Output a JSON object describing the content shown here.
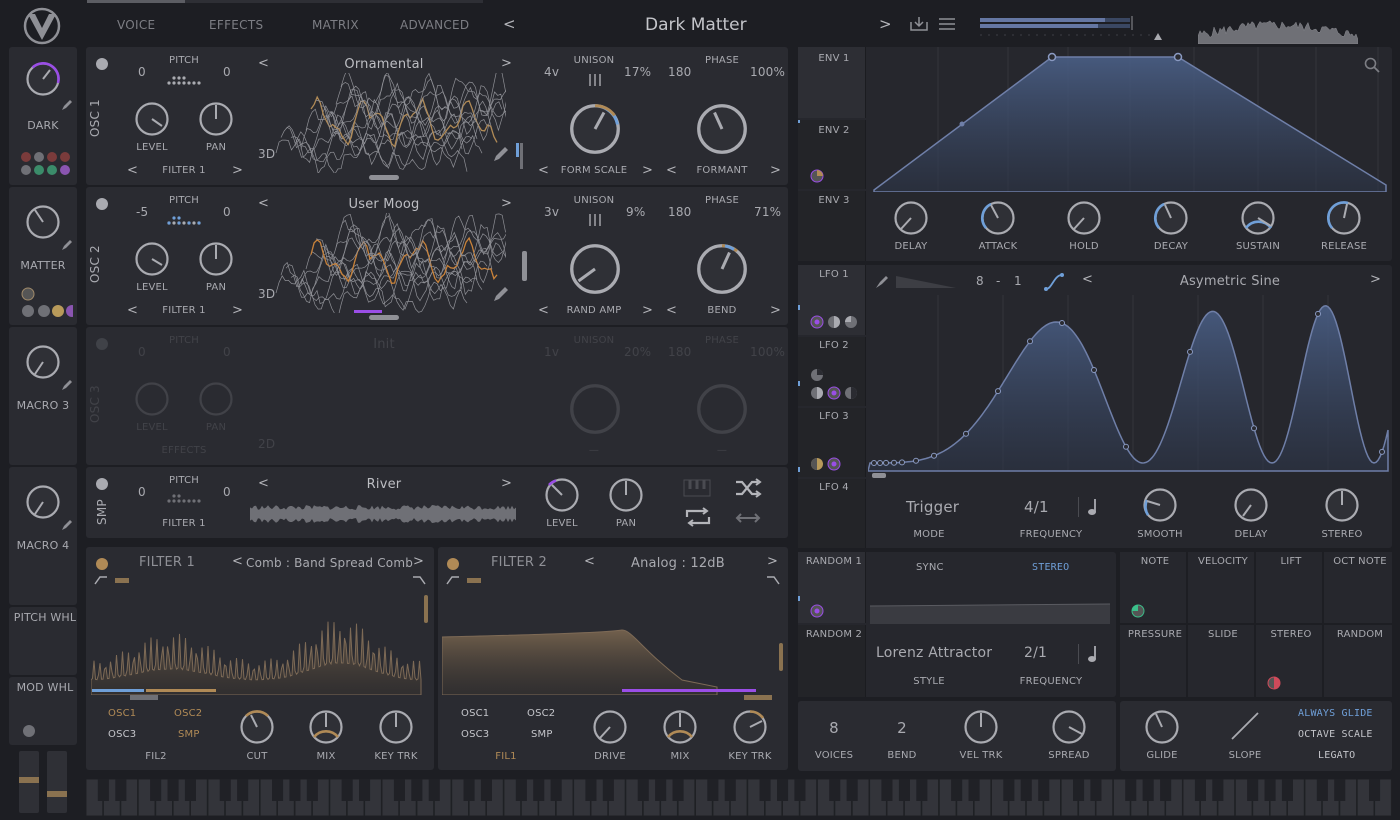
{
  "header": {
    "tabs": [
      "VOICE",
      "EFFECTS",
      "MATRIX",
      "ADVANCED"
    ],
    "preset_name": "Dark Matter",
    "prev": "<",
    "next": ">"
  },
  "macros": [
    {
      "label": "DARK"
    },
    {
      "label": "MATTER"
    },
    {
      "label": "MACRO 3"
    },
    {
      "label": "MACRO 4"
    }
  ],
  "wheels": {
    "pitch": "PITCH WHL",
    "mod": "MOD WHL"
  },
  "osc1": {
    "label": "OSC 1",
    "pitch_label": "PITCH",
    "pitch_left": "0",
    "pitch_right": "0",
    "level": "LEVEL",
    "pan": "PAN",
    "dest": "FILTER 1",
    "wavetable": "Ornamental",
    "view": "3D",
    "unison_label": "UNISON",
    "voices": "4v",
    "detune": "17%",
    "phase_label": "PHASE",
    "phase": "180",
    "phase_rand": "100%",
    "mod1": "FORM SCALE",
    "mod2": "FORMANT"
  },
  "osc2": {
    "label": "OSC 2",
    "pitch_label": "PITCH",
    "pitch_left": "-5",
    "pitch_right": "0",
    "level": "LEVEL",
    "pan": "PAN",
    "dest": "FILTER 1",
    "wavetable": "User Moog",
    "view": "3D",
    "unison_label": "UNISON",
    "voices": "3v",
    "detune": "9%",
    "phase_label": "PHASE",
    "phase": "180",
    "phase_rand": "71%",
    "mod1": "RAND AMP",
    "mod2": "BEND"
  },
  "osc3": {
    "label": "OSC 3",
    "pitch_label": "PITCH",
    "pitch_left": "0",
    "pitch_right": "0",
    "level": "LEVEL",
    "pan": "PAN",
    "dest": "EFFECTS",
    "wavetable": "Init",
    "view": "2D",
    "unison_label": "UNISON",
    "voices": "1v",
    "detune": "20%",
    "phase_label": "PHASE",
    "phase": "180",
    "phase_rand": "100%",
    "mod1": "—",
    "mod2": "—"
  },
  "smp": {
    "label": "SMP",
    "pitch_label": "PITCH",
    "pitch_left": "0",
    "pitch_right": "0",
    "dest": "FILTER 1",
    "sample": "River",
    "level": "LEVEL",
    "pan": "PAN"
  },
  "filter1": {
    "title": "FILTER 1",
    "model": "Comb : Band Spread Comb",
    "sources": [
      "OSC1",
      "OSC2",
      "OSC3",
      "SMP"
    ],
    "fil": "FIL2",
    "cut": "CUT",
    "mix": "MIX",
    "key": "KEY TRK"
  },
  "filter2": {
    "title": "FILTER 2",
    "model": "Analog : 12dB",
    "sources": [
      "OSC1",
      "OSC2",
      "OSC3",
      "SMP"
    ],
    "fil": "FIL1",
    "drive": "DRIVE",
    "mix": "MIX",
    "key": "KEY TRK"
  },
  "env": {
    "tabs": [
      "ENV 1",
      "ENV 2",
      "ENV 3"
    ],
    "knobs": [
      "DELAY",
      "ATTACK",
      "HOLD",
      "DECAY",
      "SUSTAIN",
      "RELEASE"
    ]
  },
  "lfo": {
    "tabs": [
      "LFO 1",
      "LFO 2",
      "LFO 3",
      "LFO 4"
    ],
    "grid_x": "8",
    "dash": "-",
    "grid_y": "1",
    "shape": "Asymetric Sine",
    "mode": "Trigger",
    "mode_label": "MODE",
    "freq": "4/1",
    "freq_label": "FREQUENCY",
    "smooth": "SMOOTH",
    "delay": "DELAY",
    "stereo": "STEREO"
  },
  "random": {
    "tabs": [
      "RANDOM 1",
      "RANDOM 2"
    ],
    "sync": "SYNC",
    "stereo": "STEREO",
    "style": "Lorenz Attractor",
    "style_label": "STYLE",
    "freq": "2/1",
    "freq_label": "FREQUENCY"
  },
  "mods": [
    "NOTE",
    "VELOCITY",
    "LIFT",
    "OCT NOTE",
    "PRESSURE",
    "SLIDE",
    "STEREO",
    "RANDOM"
  ],
  "voice": {
    "voices": "8",
    "voices_label": "VOICES",
    "bend": "2",
    "bend_label": "BEND",
    "veltrk": "VEL TRK",
    "spread": "SPREAD",
    "glide": "GLIDE",
    "slope": "SLOPE",
    "always_glide": "ALWAYS GLIDE",
    "octave_scale": "OCTAVE SCALE",
    "legato": "LEGATO"
  },
  "colors": {
    "accent_purple": "#9a4ee6",
    "accent_gold": "#b08a56",
    "accent_blue": "#6f9fd8",
    "env_fill": "#3d4f6e"
  }
}
